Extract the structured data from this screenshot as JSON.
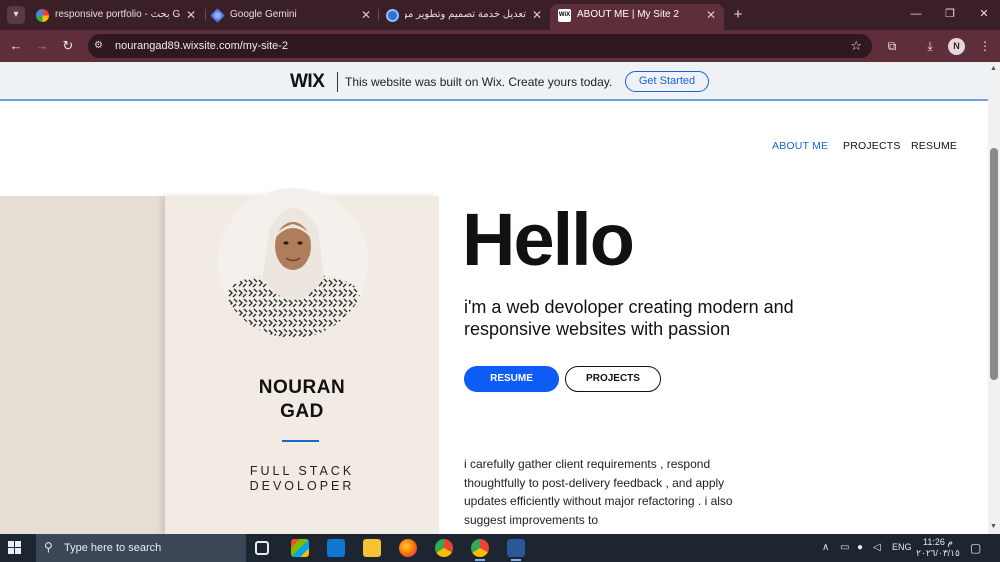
{
  "browser": {
    "tabs": [
      {
        "label": "responsive portfolio - بحث Goo",
        "close": "✕",
        "active": false
      },
      {
        "label": "Google Gemini",
        "close": "✕",
        "active": false
      },
      {
        "label": "تعديل خدمة تصميم وتطوير موقع",
        "close": "✕",
        "active": false
      },
      {
        "label": "ABOUT ME | My Site 2",
        "close": "✕",
        "active": true
      }
    ],
    "new_tab": "+",
    "window_controls": {
      "minimize": "—",
      "maximize": "❐",
      "close": "✕"
    },
    "nav": {
      "back": "←",
      "forward": "→",
      "reload": "↻"
    },
    "url": "nourangad89.wixsite.com/my-site-2",
    "profile_initial": "N"
  },
  "wix_banner": {
    "logo": "WIX",
    "text": "This website was built on Wix. Create yours today.",
    "cta": "Get Started"
  },
  "site_nav": {
    "items": [
      "ABOUT ME",
      "PROJECTS",
      "RESUME"
    ],
    "current": "ABOUT ME"
  },
  "profile": {
    "name_line1": "NOURAN",
    "name_line2": "GAD",
    "role_line1": "FULL STACK",
    "role_line2": "DEVOLOPER"
  },
  "hero": {
    "greeting": "Hello",
    "tagline": "i'm a web devoloper creating modern and responsive websites with passion",
    "btn_resume": "RESUME",
    "btn_projects": "PROJECTS",
    "about": "i carefully gather client requirements , respond thoughtfully to post-delivery feedback  , and apply updates efficiently without major refactoring . i also suggest improvements to"
  },
  "taskbar": {
    "search_placeholder": "Type here to search",
    "language": "ENG",
    "time": "11:26 م",
    "date": "٢٠٢٦/٠٣/١٥"
  },
  "colors": {
    "accent_blue": "#0d5cf5",
    "chrome_dark": "#3a1f27",
    "chrome_toolbar": "#5e2e3a",
    "card_beige": "#f2ebe4",
    "strip_beige": "#e6ddd5"
  },
  "icons": {
    "tab_favicons": [
      "google-icon",
      "gemini-icon",
      "site-icon",
      "wix-icon"
    ],
    "toolbar": [
      "site-info-icon",
      "star-icon",
      "extensions-icon",
      "download-icon",
      "menu-icon"
    ],
    "taskbar_apps": [
      "task-view-icon",
      "ms-store-icon",
      "outlook-icon",
      "file-explorer-icon",
      "firefox-icon",
      "chrome-icon",
      "chrome-profile-icon",
      "word-icon"
    ]
  }
}
